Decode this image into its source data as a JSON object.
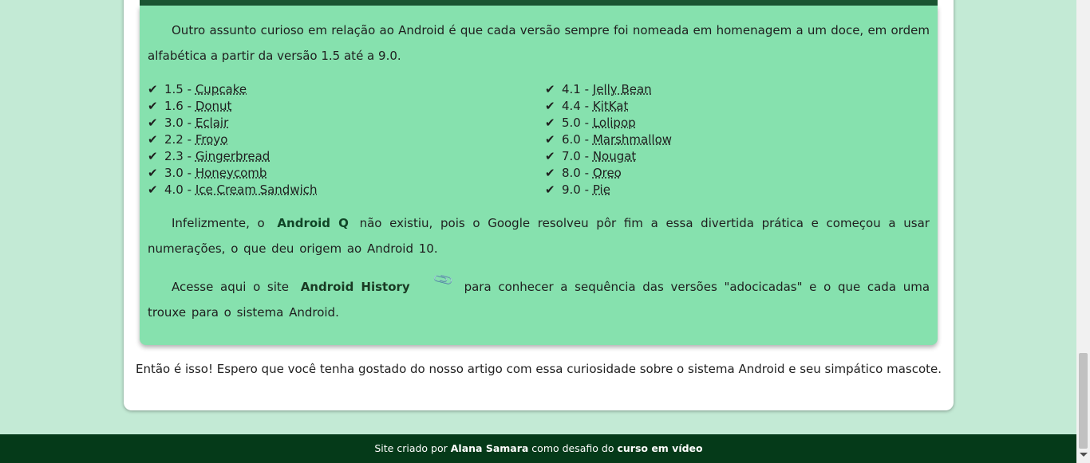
{
  "intro": "Outro assunto curioso em relação ao Android é que cada versão sempre foi nomeada em homenagem a um doce, em ordem alfabética a partir da versão 1.5 até a 9.0.",
  "check_symbol": "✔",
  "versions_left": [
    {
      "number": "1.5 - ",
      "name": "Cupcake"
    },
    {
      "number": "1.6 - ",
      "name": "Donut"
    },
    {
      "number": "3.0 - ",
      "name": "Eclair"
    },
    {
      "number": "2.2 - ",
      "name": "Froyo"
    },
    {
      "number": "2.3 - ",
      "name": "Gingerbread"
    },
    {
      "number": "3.0 - ",
      "name": "Honeycomb"
    },
    {
      "number": "4.0 - ",
      "name": "Ice Cream Sandwich"
    }
  ],
  "versions_right": [
    {
      "number": "4.1 - ",
      "name": "Jelly Bean"
    },
    {
      "number": "4.4 - ",
      "name": "KitKat"
    },
    {
      "number": "5.0 - ",
      "name": "Lolipop"
    },
    {
      "number": "6.0 - ",
      "name": "Marshmallow"
    },
    {
      "number": "7.0 - ",
      "name": "Nougat"
    },
    {
      "number": "8.0 - ",
      "name": "Oreo"
    },
    {
      "number": "9.0 - ",
      "name": "Pie"
    }
  ],
  "android_q": {
    "before": "Infelizmente, o",
    "highlight": "Android Q",
    "after": "não existiu, pois o Google resolveu pôr fim a essa divertida prática e começou a usar numerações, o que deu origem ao Android 10."
  },
  "history": {
    "before": "Acesse aqui o site",
    "link": "Android History",
    "link_icon": "paperclip-icon",
    "after": "para conhecer a sequência das versões \"adocicadas\" e o que cada uma trouxe para o sistema Android."
  },
  "closing": "Então é isso! Espero que você tenha gostado do nosso artigo com essa curiosidade sobre o sistema Android e seu simpático mascote.",
  "footer": {
    "prefix": "Site criado por ",
    "author": "Alana Samara",
    "middle": " como desafio do ",
    "course": "curso em vídeo"
  },
  "colors": {
    "page_bg": "#c3ead5",
    "box_bg": "#86e1ae",
    "box_top_bar": "#1a5532",
    "footer_bg": "#053a19"
  }
}
